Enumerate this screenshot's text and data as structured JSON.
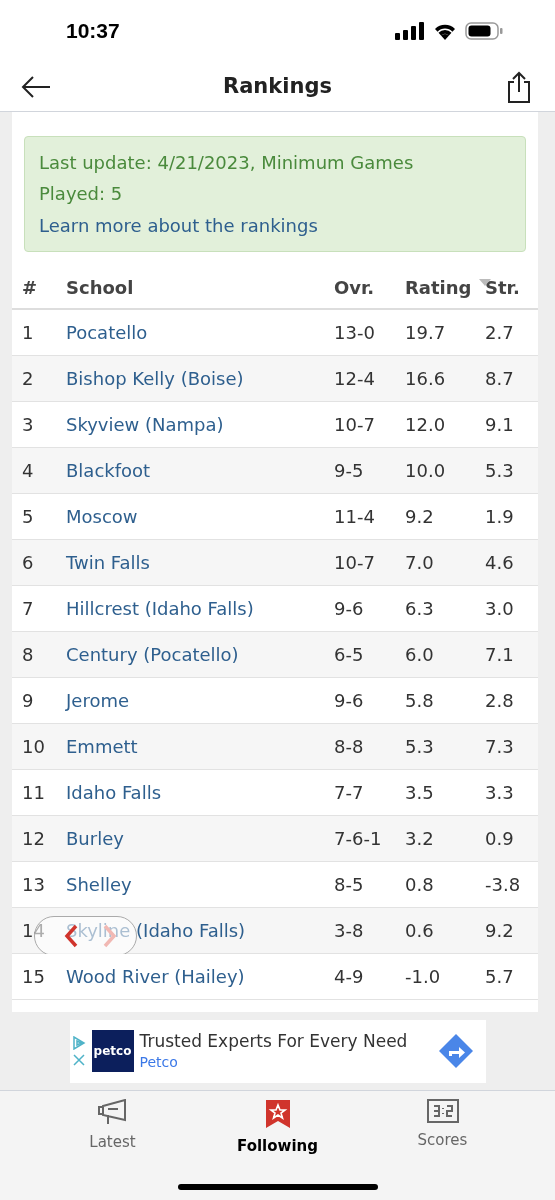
{
  "status_bar": {
    "time": "10:37"
  },
  "nav": {
    "title": "Rankings"
  },
  "notice": {
    "text": "Last update: 4/21/2023, Minimum Games Played: 5",
    "link": "Learn more about the rankings"
  },
  "table": {
    "columns": [
      "#",
      "School",
      "Ovr.",
      "Rating",
      "Str."
    ],
    "rows": [
      [
        "1",
        "Pocatello",
        "13-0",
        "19.7",
        "2.7"
      ],
      [
        "2",
        "Bishop Kelly (Boise)",
        "12-4",
        "16.6",
        "8.7"
      ],
      [
        "3",
        "Skyview (Nampa)",
        "10-7",
        "12.0",
        "9.1"
      ],
      [
        "4",
        "Blackfoot",
        "9-5",
        "10.0",
        "5.3"
      ],
      [
        "5",
        "Moscow",
        "11-4",
        "9.2",
        "1.9"
      ],
      [
        "6",
        "Twin Falls",
        "10-7",
        "7.0",
        "4.6"
      ],
      [
        "7",
        "Hillcrest (Idaho Falls)",
        "9-6",
        "6.3",
        "3.0"
      ],
      [
        "8",
        "Century (Pocatello)",
        "6-5",
        "6.0",
        "7.1"
      ],
      [
        "9",
        "Jerome",
        "9-6",
        "5.8",
        "2.8"
      ],
      [
        "10",
        "Emmett",
        "8-8",
        "5.3",
        "7.3"
      ],
      [
        "11",
        "Idaho Falls",
        "7-7",
        "3.5",
        "3.3"
      ],
      [
        "12",
        "Burley",
        "7-6-1",
        "3.2",
        "0.9"
      ],
      [
        "13",
        "Shelley",
        "8-5",
        "0.8",
        "-3.8"
      ],
      [
        "14",
        "Skyline (Idaho Falls)",
        "3-8",
        "0.6",
        "9.2"
      ],
      [
        "15",
        "Wood River (Hailey)",
        "4-9",
        "-1.0",
        "5.7"
      ]
    ]
  },
  "ad": {
    "logo": "petco",
    "headline": "Trusted Experts For Every Need",
    "advertiser": "Petco"
  },
  "tabs": [
    {
      "label": "Latest",
      "selected": false,
      "kind": "megaphone"
    },
    {
      "label": "Following",
      "selected": true,
      "kind": "bookmark"
    },
    {
      "label": "Scores",
      "selected": false,
      "kind": "scoreboard"
    }
  ]
}
